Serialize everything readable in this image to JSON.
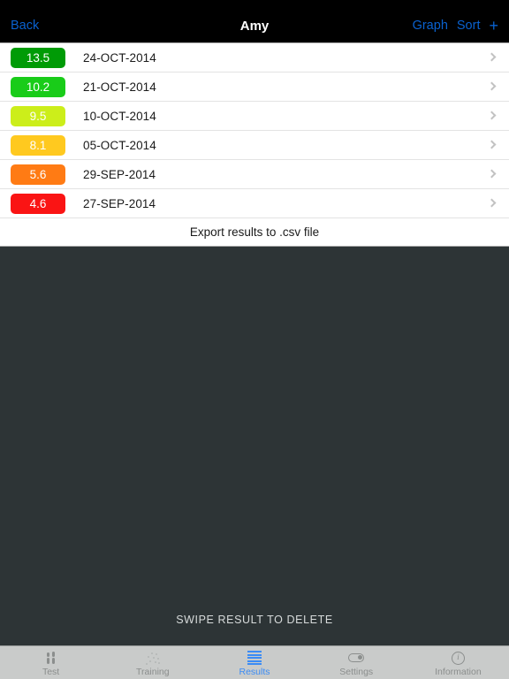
{
  "navbar": {
    "back_label": "Back",
    "title": "Amy",
    "graph_label": "Graph",
    "sort_label": "Sort",
    "add_label": "+",
    "tint_color": "#0a62d0",
    "background": "#000000"
  },
  "results": {
    "rows": [
      {
        "value": "13.5",
        "date": "24-OCT-2014",
        "color": "#009b06"
      },
      {
        "value": "10.2",
        "date": "21-OCT-2014",
        "color": "#19cc19"
      },
      {
        "value": "9.5",
        "date": "10-OCT-2014",
        "color": "#ccee1a"
      },
      {
        "value": "8.1",
        "date": "05-OCT-2014",
        "color": "#ffc91f"
      },
      {
        "value": "5.6",
        "date": "29-SEP-2014",
        "color": "#ff7b14"
      },
      {
        "value": "4.6",
        "date": "27-SEP-2014",
        "color": "#fa1414"
      }
    ],
    "export_label": "Export results to .csv file"
  },
  "body": {
    "hint": "SWIPE RESULT TO DELETE",
    "background": "#2d3436"
  },
  "tabbar": {
    "active_color": "#3b8cf5",
    "inactive_color": "#8b8e8d",
    "background": "#c9cbca",
    "tabs": [
      {
        "label": "Test",
        "icon": "people-icon",
        "active": false
      },
      {
        "label": "Training",
        "icon": "dots-icon",
        "active": false
      },
      {
        "label": "Results",
        "icon": "list-icon",
        "active": true
      },
      {
        "label": "Settings",
        "icon": "toggle-icon",
        "active": false
      },
      {
        "label": "Information",
        "icon": "info-icon",
        "active": false
      }
    ]
  }
}
